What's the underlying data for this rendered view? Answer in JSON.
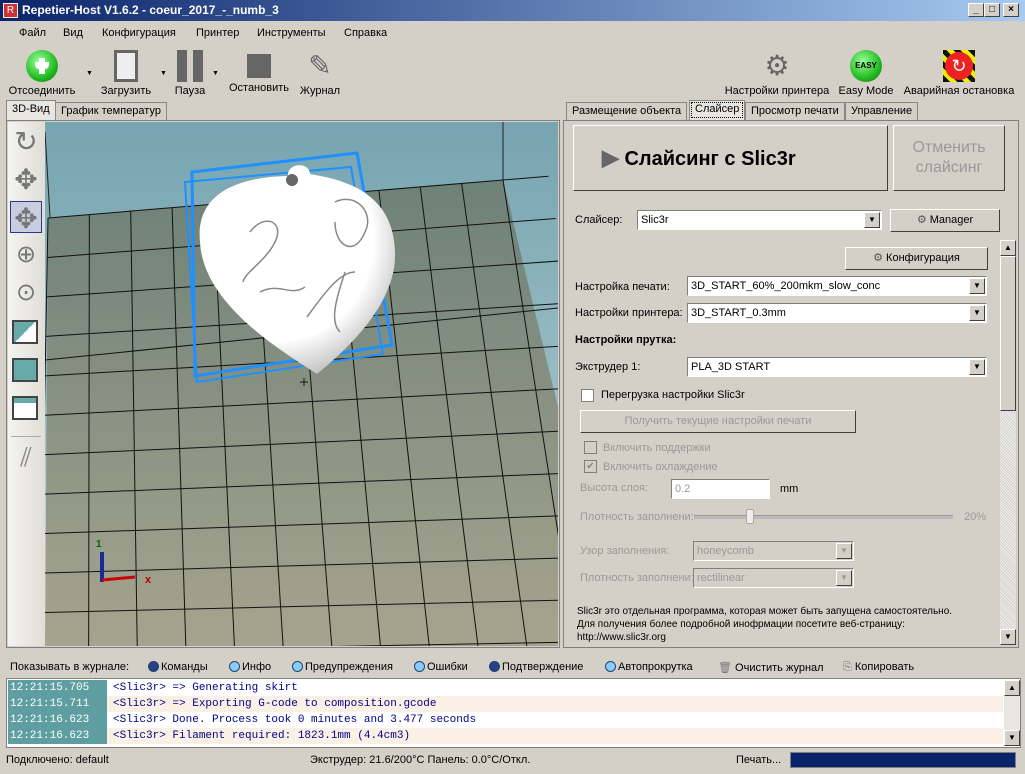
{
  "window": {
    "title": "Repetier-Host V1.6.2 - coeur_2017_-_numb_3",
    "app_icon_letter": "R",
    "controls": [
      "_",
      "□",
      "×"
    ]
  },
  "menu": [
    "Файл",
    "Вид",
    "Конфигурация",
    "Принтер",
    "Инструменты",
    "Справка"
  ],
  "toolbar": {
    "disconnect": "Отсоединить",
    "load": "Загрузить",
    "pause": "Пауза",
    "stop": "Остановить",
    "log": "Журнал",
    "printer_settings": "Настройки принтера",
    "easy_mode": "Easy Mode",
    "easy_badge": "EASY",
    "emergency_stop": "Аварийная остановка"
  },
  "left_tabs": [
    "3D-Вид",
    "График температур"
  ],
  "right_tabs": [
    "Размещение объекта",
    "Слайсер",
    "Просмотр печати",
    "Управление"
  ],
  "slicer": {
    "slice_button": "Слайсинг с Slic3r",
    "cancel_button": "Отменить слайсинг",
    "slicer_label": "Слайсер:",
    "slicer_value": "Slic3r",
    "manager_button": "Manager",
    "config_button": "Конфигурация",
    "print_settings_label": "Настройка печати:",
    "print_settings_value": "3D_START_60%_200mkm_slow_conc",
    "printer_settings_label": "Настройки принтера:",
    "printer_settings_value": "3D_START_0.3mm",
    "filament_heading": "Настройки прутка:",
    "extruder_label": "Экструдер 1:",
    "extruder_value": "PLA_3D START",
    "override_label": "Перегрузка настройки Slic3r",
    "override_checked": false,
    "get_settings_button": "Получить текущие настройки печати",
    "support_label": "Включить поддержки",
    "support_checked": false,
    "cooling_label": "Включить охлаждение",
    "cooling_checked": true,
    "layer_height_label": "Высота слоя:",
    "layer_height_value": "0.2",
    "layer_height_unit": "mm",
    "infill_density_label": "Плотность заполнени:",
    "infill_density_value": "20%",
    "infill_density_fraction": 0.2,
    "infill_pattern_label": "Узор заполнения:",
    "infill_pattern_value": "honeycomb",
    "infill_density2_label": "Плотность заполнени:",
    "infill_density2_value": "rectilinear",
    "info_line1": "Slic3r это отдельная программа, которая может быть запущена самостоятельно.",
    "info_line2": "Для получения более подробной инофрмации посетите веб-страницу:",
    "info_link": "http://www.slic3r.org"
  },
  "log_filter": {
    "label": "Показывать в журнале:",
    "commands": "Команды",
    "info": "Инфо",
    "warnings": "Предупреждения",
    "errors": "Ошибки",
    "ack": "Подтверждение",
    "autoscroll": "Автопрокрутка",
    "clear": "Очистить журнал",
    "copy": "Копировать"
  },
  "log": [
    {
      "time": "12:21:15.705",
      "msg": "<Slic3r> => Generating skirt"
    },
    {
      "time": "12:21:15.711",
      "msg": "<Slic3r> => Exporting G-code to composition.gcode"
    },
    {
      "time": "12:21:16.623",
      "msg": "<Slic3r> Done. Process took 0 minutes and 3.477 seconds"
    },
    {
      "time": "12:21:16.623",
      "msg": "<Slic3r> Filament required: 1823.1mm (4.4cm3)"
    }
  ],
  "status": {
    "connected": "Подключено: default",
    "temps": "Экструдер: 21.6/200°C Панель: 0.0°C/Откл.",
    "printing": "Печать...",
    "progress_color": "#0a246a"
  },
  "viewport": {
    "axis_x": "x",
    "axis_y": "1",
    "accent": "#1e90ff"
  }
}
